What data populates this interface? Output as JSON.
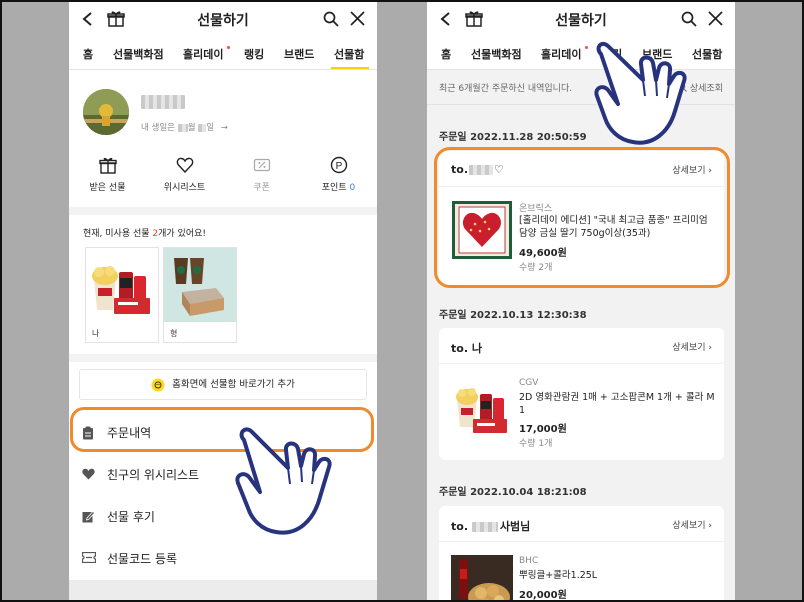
{
  "header": {
    "title": "선물하기"
  },
  "tabs_left": [
    "홈",
    "선물백화점",
    "홀리데이",
    "랭킹",
    "브랜드",
    "선물함"
  ],
  "tabs_right": [
    "홈",
    "선물백화점",
    "홀리데이",
    "랭킹",
    "브랜드",
    "선물함"
  ],
  "profile": {
    "birthday_prefix": "내 생일은",
    "birthday_month_suffix": "월",
    "birthday_day_suffix": "일"
  },
  "quick_menu": [
    {
      "label": "받은 선물",
      "icon": "gift-icon"
    },
    {
      "label": "위시리스트",
      "icon": "heart-icon"
    },
    {
      "label": "쿠폰",
      "icon": "coupon-icon"
    },
    {
      "label": "포인트",
      "icon": "point-icon",
      "value": "0"
    }
  ],
  "unused_gifts": {
    "prefix": "현재, 미사용 선물 ",
    "count": "2",
    "suffix": "개가 있어요!",
    "items": [
      {
        "name": "나"
      },
      {
        "name": "형"
      }
    ]
  },
  "home_shortcut": "홈화면에 선물함 바로가기 추가",
  "menu": [
    {
      "label": "주문내역",
      "icon": "clipboard-icon"
    },
    {
      "label": "친구의 위시리스트",
      "icon": "heart-icon"
    },
    {
      "label": "선물 후기",
      "icon": "edit-icon"
    },
    {
      "label": "선물코드 등록",
      "icon": "ticket-icon"
    }
  ],
  "orders_page": {
    "notice": "최근 6개월간 주문하신 내역입니다.",
    "detail_search": "상세조회",
    "orders": [
      {
        "date": "주문일 2022.11.28 20:50:59",
        "to_prefix": "to.",
        "to_suffix": "♡",
        "detail": "상세보기",
        "brand": "온브릭스",
        "product": "[홀리데이 에디션] \"국내 최고급 품종\" 프리미엄 담양 금실 딸기 750g이상(35과)",
        "price": "49,600원",
        "qty": "수량 2개"
      },
      {
        "date": "주문일 2022.10.13 12:30:38",
        "to_prefix": "to.",
        "to_suffix": "나",
        "detail": "상세보기",
        "brand": "CGV",
        "product": "2D 영화관람권 1매 + 고소팝콘M 1개 + 콜라 M 1",
        "price": "17,000원",
        "qty": "수량 1개"
      },
      {
        "date": "주문일 2022.10.04 18:21:08",
        "to_prefix": "to.",
        "to_suffix": "사범님",
        "detail": "상세보기",
        "brand": "BHC",
        "product": "뿌링클+콜라1.25L",
        "price": "20,000원",
        "qty": ""
      }
    ]
  },
  "colors": {
    "accent_yellow": "#ffcd00",
    "highlight_orange": "#f08a2a",
    "point_blue": "#3a7bd5",
    "count_red": "#ff3b30"
  }
}
